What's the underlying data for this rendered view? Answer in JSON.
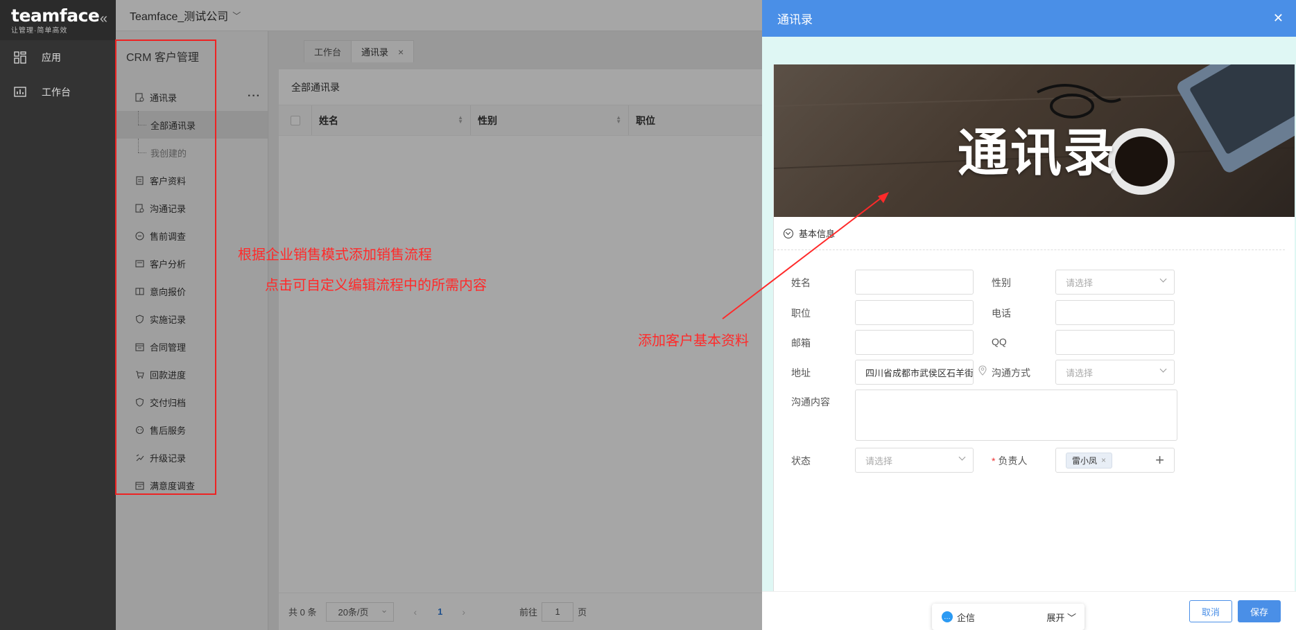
{
  "brand": {
    "name": "teamface",
    "slogan": "让管理·简单高效"
  },
  "rail": {
    "items": [
      {
        "label": "应用",
        "icon": "apps-icon"
      },
      {
        "label": "工作台",
        "icon": "dashboard-icon"
      }
    ]
  },
  "topbar": {
    "company": "Teamface_测试公司"
  },
  "module": {
    "title": "CRM 客户管理",
    "items": [
      {
        "label": "通讯录",
        "icon": "contacts-icon"
      },
      {
        "label": "全部通讯录",
        "sub": true
      },
      {
        "label": "我创建的",
        "sub": true
      },
      {
        "label": "客户资料",
        "icon": "document-icon"
      },
      {
        "label": "沟通记录",
        "icon": "chat-record-icon"
      },
      {
        "label": "售前调查",
        "icon": "survey-icon"
      },
      {
        "label": "客户分析",
        "icon": "analysis-icon"
      },
      {
        "label": "意向报价",
        "icon": "quote-icon"
      },
      {
        "label": "实施记录",
        "icon": "shield-icon"
      },
      {
        "label": "合同管理",
        "icon": "contract-icon"
      },
      {
        "label": "回款进度",
        "icon": "cart-icon"
      },
      {
        "label": "交付归档",
        "icon": "archive-icon"
      },
      {
        "label": "售后服务",
        "icon": "service-icon"
      },
      {
        "label": "升级记录",
        "icon": "upgrade-icon"
      },
      {
        "label": "满意度调查",
        "icon": "satisfaction-icon"
      }
    ]
  },
  "tabs": [
    {
      "label": "工作台"
    },
    {
      "label": "通讯录"
    }
  ],
  "list": {
    "title": "全部通讯录",
    "columns": [
      "姓名",
      "性别",
      "职位"
    ],
    "pager": {
      "total": "共 0 条",
      "page_size": "20条/页",
      "current": "1",
      "goto": "前往",
      "goto_value": "1",
      "page_unit": "页"
    }
  },
  "annotations": {
    "a1": "根据企业销售模式添加销售流程",
    "a2": "点击可自定义编辑流程中的所需内容",
    "a3": "添加客户基本资料"
  },
  "drawer": {
    "title": "通讯录",
    "banner_title": "通讯录",
    "section": "基本信息",
    "fields": {
      "name": {
        "label": "姓名",
        "value": ""
      },
      "gender": {
        "label": "性别",
        "placeholder": "请选择"
      },
      "position": {
        "label": "职位",
        "value": ""
      },
      "phone": {
        "label": "电话",
        "value": ""
      },
      "email": {
        "label": "邮箱",
        "value": ""
      },
      "qq": {
        "label": "QQ",
        "value": ""
      },
      "address": {
        "label": "地址",
        "value": "四川省成都市武侯区石羊街"
      },
      "contact_method": {
        "label": "沟通方式",
        "placeholder": "请选择"
      },
      "content": {
        "label": "沟通内容",
        "value": ""
      },
      "status": {
        "label": "状态",
        "placeholder": "请选择"
      },
      "owner": {
        "label": "负责人",
        "required_mark": "*",
        "tag": "雷小凤",
        "tag_remove": "×",
        "add": "+"
      }
    },
    "buttons": {
      "cancel": "取消",
      "save": "保存"
    }
  },
  "im": {
    "label": "企信",
    "expand": "展开"
  },
  "colors": {
    "accent": "#4a8fe7",
    "annotation": "#ff2a2a",
    "rail": "#333333"
  }
}
